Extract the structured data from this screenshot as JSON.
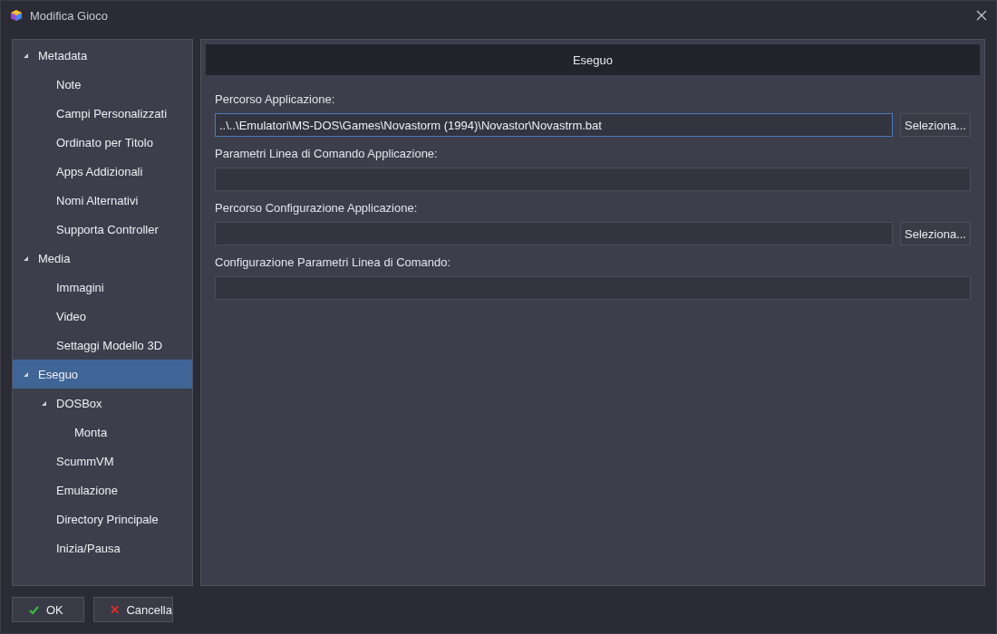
{
  "window": {
    "title": "Modifica Gioco"
  },
  "sidebar": {
    "items": [
      {
        "label": "Metadata",
        "expanded": true,
        "selected": false,
        "children": [
          {
            "label": "Note",
            "selected": false
          },
          {
            "label": "Campi Personalizzati",
            "selected": false
          },
          {
            "label": "Ordinato per Titolo",
            "selected": false
          },
          {
            "label": "Apps Addizionali",
            "selected": false
          },
          {
            "label": "Nomi Alternativi",
            "selected": false
          },
          {
            "label": "Supporta Controller",
            "selected": false
          }
        ]
      },
      {
        "label": "Media",
        "expanded": true,
        "selected": false,
        "children": [
          {
            "label": "Immagini",
            "selected": false
          },
          {
            "label": "Video",
            "selected": false
          },
          {
            "label": "Settaggi Modello 3D",
            "selected": false
          }
        ]
      },
      {
        "label": "Eseguo",
        "expanded": true,
        "selected": true,
        "children": [
          {
            "label": "DOSBox",
            "expanded": true,
            "selected": false,
            "children": [
              {
                "label": "Monta",
                "selected": false
              }
            ]
          },
          {
            "label": "ScummVM",
            "selected": false
          },
          {
            "label": "Emulazione",
            "selected": false
          },
          {
            "label": "Directory Principale",
            "selected": false
          },
          {
            "label": "Inizia/Pausa",
            "selected": false
          }
        ]
      }
    ]
  },
  "panel": {
    "title": "Eseguo",
    "fields": [
      {
        "label": "Percorso Applicazione:",
        "value": "..\\..\\Emulatori\\MS-DOS\\Games\\Novastorm (1994)\\Novastor\\Novastrm.bat",
        "focused": true,
        "button": "Seleziona..."
      },
      {
        "label": "Parametri Linea di Comando Applicazione:",
        "focused": false
      },
      {
        "label": "Percorso Configurazione Applicazione:",
        "focused": false,
        "button": "Seleziona..."
      },
      {
        "label": "Configurazione Parametri Linea di Comando:",
        "focused": false
      }
    ]
  },
  "buttons": [
    {
      "kind": "ok",
      "label": "OK"
    },
    {
      "kind": "cancel",
      "label": "Cancella"
    }
  ]
}
